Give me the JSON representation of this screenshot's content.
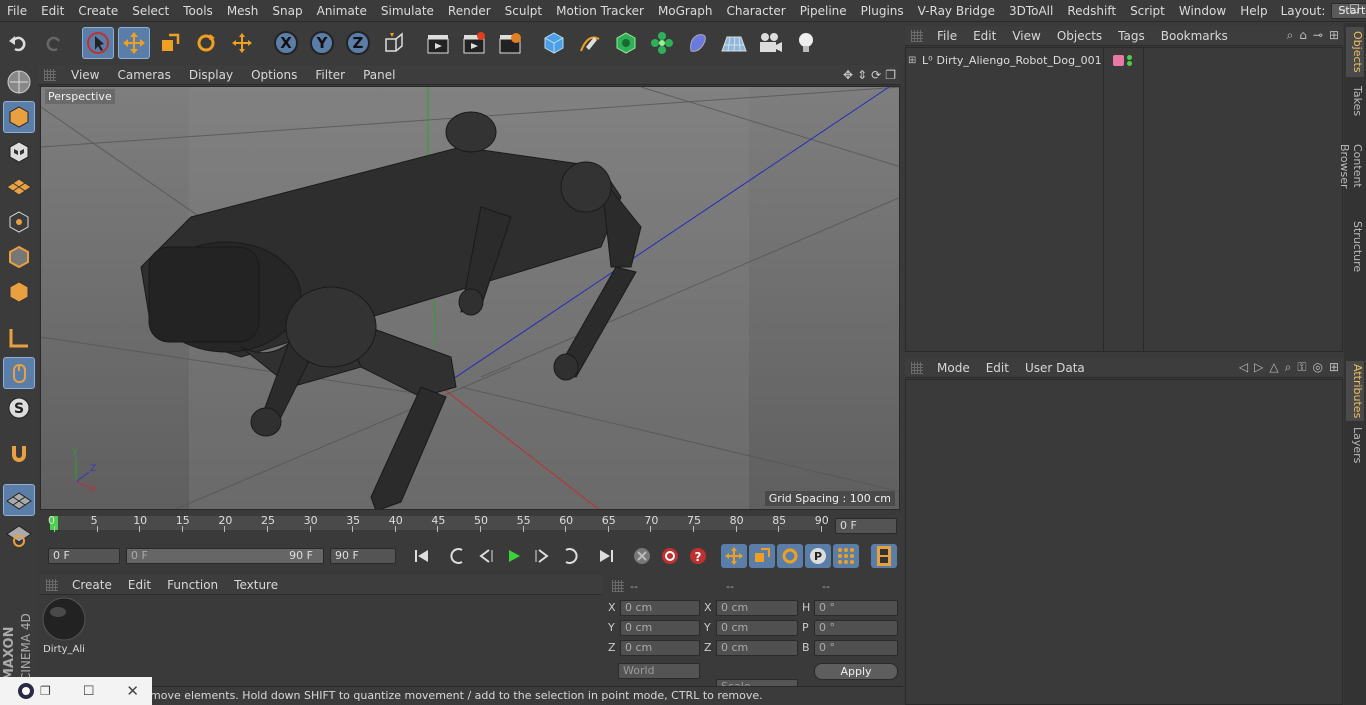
{
  "menu": [
    "File",
    "Edit",
    "Create",
    "Select",
    "Tools",
    "Mesh",
    "Snap",
    "Animate",
    "Simulate",
    "Render",
    "Sculpt",
    "Motion Tracker",
    "MoGraph",
    "Character",
    "Pipeline",
    "Plugins",
    "V-Ray Bridge",
    "3DToAll",
    "Redshift",
    "Script",
    "Window",
    "Help"
  ],
  "layout": {
    "label": "Layout:",
    "value": "Startup"
  },
  "toolbar": {
    "axis_x": "X",
    "axis_y": "Y",
    "axis_z": "Z"
  },
  "viewport": {
    "menu": [
      "View",
      "Cameras",
      "Display",
      "Options",
      "Filter",
      "Panel"
    ],
    "label": "Perspective",
    "grid_spacing": "Grid Spacing : 100 cm"
  },
  "timeline": {
    "ticks": [
      "0",
      "5",
      "10",
      "15",
      "20",
      "25",
      "30",
      "35",
      "40",
      "45",
      "50",
      "55",
      "60",
      "65",
      "70",
      "75",
      "80",
      "85",
      "90"
    ],
    "current_frame": "0 F"
  },
  "anim": {
    "start": "0 F",
    "range_start": "0 F",
    "range_end": "90 F",
    "end": "90 F"
  },
  "material": {
    "menu": [
      "Create",
      "Edit",
      "Function",
      "Texture"
    ],
    "name": "Dirty_Ali"
  },
  "coord": {
    "headers": [
      "--",
      "--",
      "--"
    ],
    "rows": [
      {
        "a": "X",
        "av": "0 cm",
        "b": "X",
        "bv": "0 cm",
        "c": "H",
        "cv": "0 °"
      },
      {
        "a": "Y",
        "av": "0 cm",
        "b": "Y",
        "bv": "0 cm",
        "c": "P",
        "cv": "0 °"
      },
      {
        "a": "Z",
        "av": "0 cm",
        "b": "Z",
        "bv": "0 cm",
        "c": "B",
        "cv": "0 °"
      }
    ],
    "mode": "World",
    "type": "Scale",
    "apply": "Apply"
  },
  "objects": {
    "menu": [
      "File",
      "Edit",
      "View",
      "Objects",
      "Tags",
      "Bookmarks"
    ],
    "items": [
      {
        "name": "Dirty_Aliengo_Robot_Dog_001",
        "tag_color": "#e879a6"
      }
    ]
  },
  "attributes": {
    "menu": [
      "Mode",
      "Edit",
      "User Data"
    ]
  },
  "side_tabs": [
    "Objects",
    "Takes",
    "Content Browser",
    "Structure"
  ],
  "side_tabs_lower": [
    "Attributes",
    "Layers"
  ],
  "status": "move elements. Hold down SHIFT to quantize movement / add to the selection in point mode, CTRL to remove.",
  "brand": {
    "maxon": "MAXON",
    "cinema": "CINEMA 4D"
  },
  "colors": {
    "accent": "#5b7ea8",
    "x_axis": "#c03030",
    "y_axis": "#2ea02e",
    "z_axis": "#3535c8"
  }
}
